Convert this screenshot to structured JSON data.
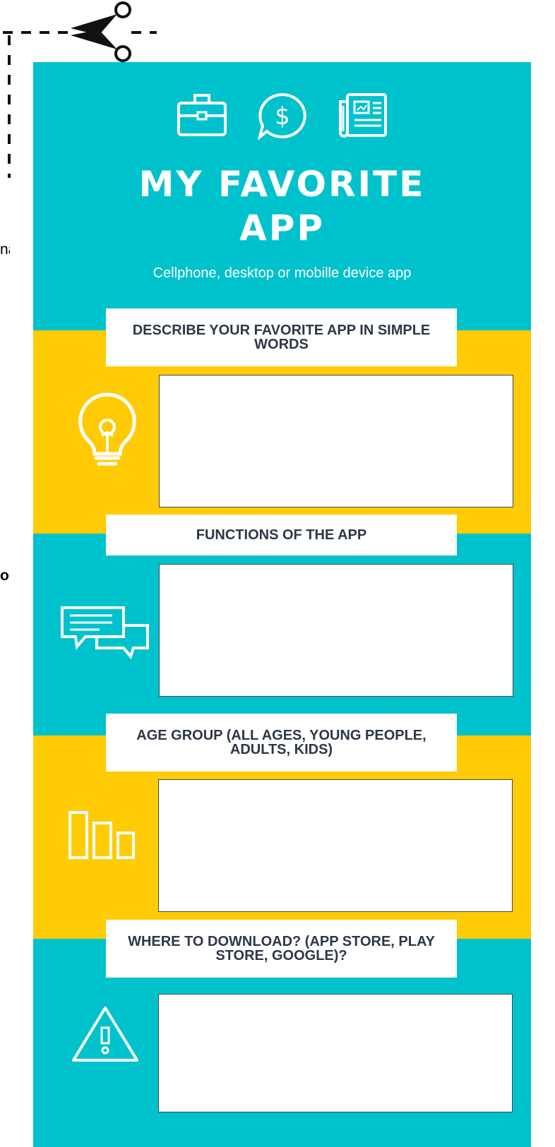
{
  "poster": {
    "title_line1": "MY FAVORITE",
    "title_line2": "APP",
    "subtitle": "Cellphone, desktop or mobille device app",
    "colors": {
      "teal": "#00c2cc",
      "yellow": "#ffcb05",
      "text_dark": "#2e3747"
    }
  },
  "sections": [
    {
      "heading": "DESCRIBE YOUR FAVORITE APP IN SIMPLE WORDS",
      "icon": "lightbulb-icon"
    },
    {
      "heading": "FUNCTIONS OF THE APP",
      "icon": "chat-bubbles-icon"
    },
    {
      "heading": "AGE GROUP (ALL AGES, YOUNG PEOPLE, ADULTS, KIDS)",
      "icon": "bar-chart-icon"
    },
    {
      "heading": "WHERE TO DOWNLOAD? (APP STORE, PLAY STORE, GOOGLE)?",
      "icon": "warning-icon"
    }
  ],
  "header_icons": [
    "briefcase-icon",
    "dollar-chat-icon",
    "newspaper-icon"
  ],
  "side_text": {
    "fragment1": "na",
    "fragment2": "o"
  }
}
